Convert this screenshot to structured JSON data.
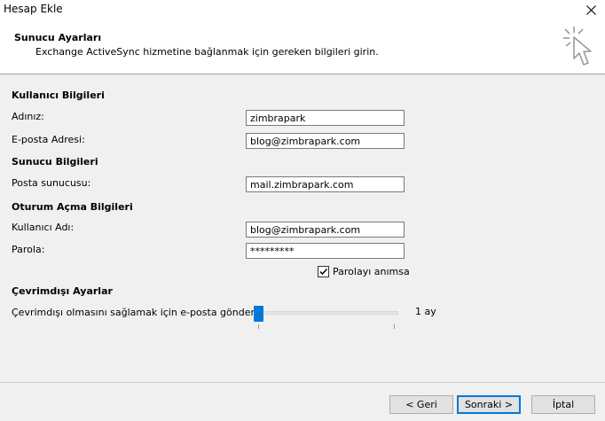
{
  "window": {
    "title": "Hesap Ekle"
  },
  "header": {
    "title": "Sunucu Ayarları",
    "subtitle": "Exchange ActiveSync hizmetine bağlanmak için gereken bilgileri girin."
  },
  "user_info": {
    "section_title": "Kullanıcı Bilgileri",
    "name_label": "Adınız:",
    "name_value": "zimbrapark",
    "email_label": "E-posta Adresi:",
    "email_value": "blog@zimbrapark.com"
  },
  "server_info": {
    "section_title": "Sunucu Bilgileri",
    "mail_server_label": "Posta sunucusu:",
    "mail_server_value": "mail.zimbrapark.com"
  },
  "logon_info": {
    "section_title": "Oturum Açma Bilgileri",
    "username_label": "Kullanıcı Adı:",
    "username_value": "blog@zimbrapark.com",
    "password_label": "Parola:",
    "password_value": "*********",
    "remember_label": "Parolayı anımsa",
    "remember_checked": true
  },
  "offline": {
    "section_title": "Çevrimdışı Ayarlar",
    "slider_label": "Çevrimdışı olmasını sağlamak için e-posta gönder:",
    "slider_value": "1 ay",
    "slider_level": 0.0
  },
  "buttons": {
    "back": "< Geri",
    "next": "Sonraki >",
    "cancel": "İptal"
  },
  "colors": {
    "accent": "#0078d7"
  }
}
